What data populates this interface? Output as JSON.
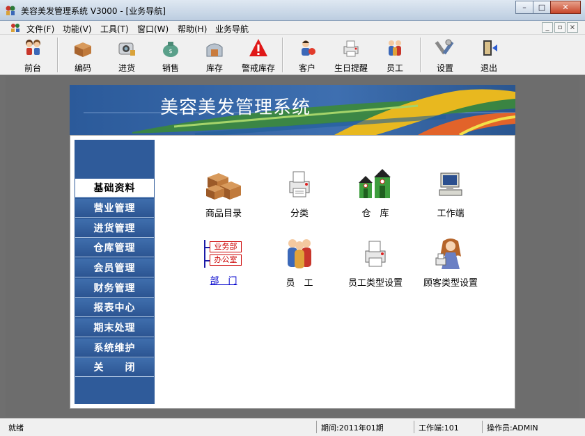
{
  "window": {
    "title": "美容美发管理系统 V3000 - [业务导航]",
    "minimize": "–",
    "maximize": "□",
    "close": "✕"
  },
  "menu": {
    "items": [
      "文件(F)",
      "功能(V)",
      "工具(T)",
      "窗口(W)",
      "帮助(H)",
      "业务导航"
    ],
    "mdi_buttons": [
      "_",
      "▫",
      "×"
    ]
  },
  "toolbar": {
    "items": [
      {
        "label": "前台",
        "icon": "people-icon"
      },
      {
        "label": "编码",
        "icon": "boxes-icon"
      },
      {
        "label": "进货",
        "icon": "camera-icon"
      },
      {
        "label": "销售",
        "icon": "money-bag-icon"
      },
      {
        "label": "库存",
        "icon": "warehouse-icon"
      },
      {
        "label": "警戒库存",
        "icon": "warning-icon"
      },
      {
        "label": "客户",
        "icon": "customer-icon"
      },
      {
        "label": "生日提醒",
        "icon": "printer-icon"
      },
      {
        "label": "员工",
        "icon": "staff-icon"
      },
      {
        "label": "设置",
        "icon": "tools-icon"
      },
      {
        "label": "退出",
        "icon": "exit-door-icon"
      }
    ]
  },
  "banner": {
    "title": "美容美发管理系统"
  },
  "nav": {
    "items": [
      "基础资料",
      "营业管理",
      "进货管理",
      "仓库管理",
      "会员管理",
      "财务管理",
      "报表中心",
      "期末处理",
      "系统维护",
      "关　　闭"
    ],
    "active_index": 0
  },
  "features": {
    "items": [
      {
        "label": "商品目录",
        "icon": "boxes-icon"
      },
      {
        "label": "分类",
        "icon": "printer-icon"
      },
      {
        "label": "仓　库",
        "icon": "warehouse-icon"
      },
      {
        "label": "工作端",
        "icon": "computer-icon"
      },
      {
        "label": "部　门",
        "icon": "department-icon",
        "sub": [
          "业务部",
          "办公室"
        ]
      },
      {
        "label": "员　工",
        "icon": "staff-icon"
      },
      {
        "label": "员工类型设置",
        "icon": "printer-icon"
      },
      {
        "label": "顾客类型设置",
        "icon": "customer-girl-icon"
      }
    ]
  },
  "status": {
    "ready": "就绪",
    "period": "期间:2011年01期",
    "workstation": "工作端:101",
    "operator": "操作员:ADMIN"
  },
  "colors": {
    "nav_blue": "#2f5b9a",
    "banner_blue": "#3e6fb0",
    "link_blue": "#0000cc"
  }
}
